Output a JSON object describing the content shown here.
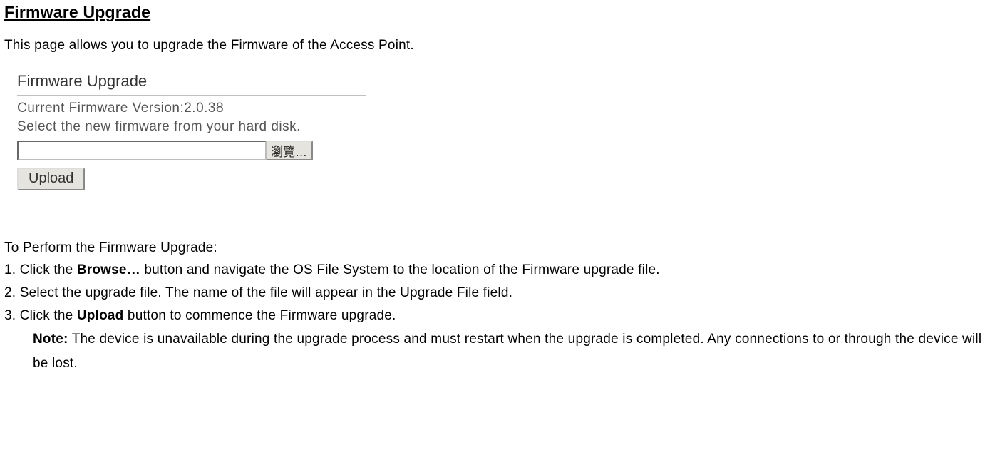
{
  "title": "Firmware Upgrade",
  "intro": "This page allows you to upgrade the Firmware of the Access Point.",
  "panel": {
    "heading": "Firmware Upgrade",
    "version_line": "Current Firmware Version:2.0.38",
    "select_line": "Select the new firmware from your hard disk.",
    "file_value": "",
    "browse_label": "瀏覽…",
    "upload_label": "Upload"
  },
  "instructions": {
    "heading": "To Perform the Firmware Upgrade:",
    "steps": [
      {
        "pre": "1. Click the ",
        "bold": "Browse…",
        "post": " button and navigate the OS File System to the location of the Firmware upgrade file."
      },
      {
        "pre": "2. Select the upgrade file. The name of the file will appear in the Upgrade File field.",
        "bold": "",
        "post": ""
      },
      {
        "pre": "3. Click the ",
        "bold": "Upload",
        "post": " button to commence the Firmware upgrade."
      }
    ],
    "note_bold": "Note:",
    "note_text": " The device is unavailable during the upgrade process and must restart when the upgrade is completed. Any connections to or through the device will be lost."
  }
}
